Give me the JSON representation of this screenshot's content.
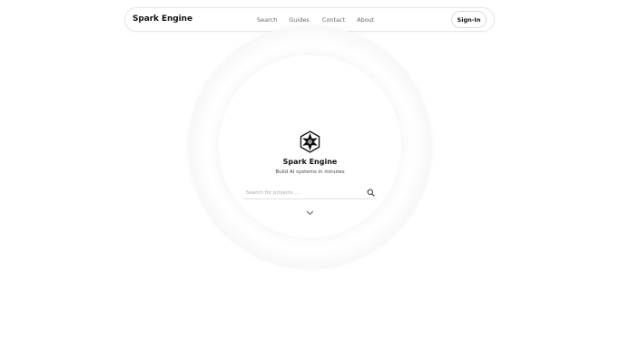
{
  "header": {
    "brand": "Spark Engine",
    "nav": [
      {
        "label": "Search"
      },
      {
        "label": "Guides"
      },
      {
        "label": "Contact"
      },
      {
        "label": "About"
      }
    ],
    "sign_in_label": "Sign-In"
  },
  "hero": {
    "logo_icon": "hexagon-star-logo-icon",
    "title": "Spark Engine",
    "subtitle": "Build AI systems in minutes",
    "search": {
      "placeholder": "Search for projects ...",
      "value": ""
    },
    "scroll_icon": "chevron-down-icon"
  }
}
